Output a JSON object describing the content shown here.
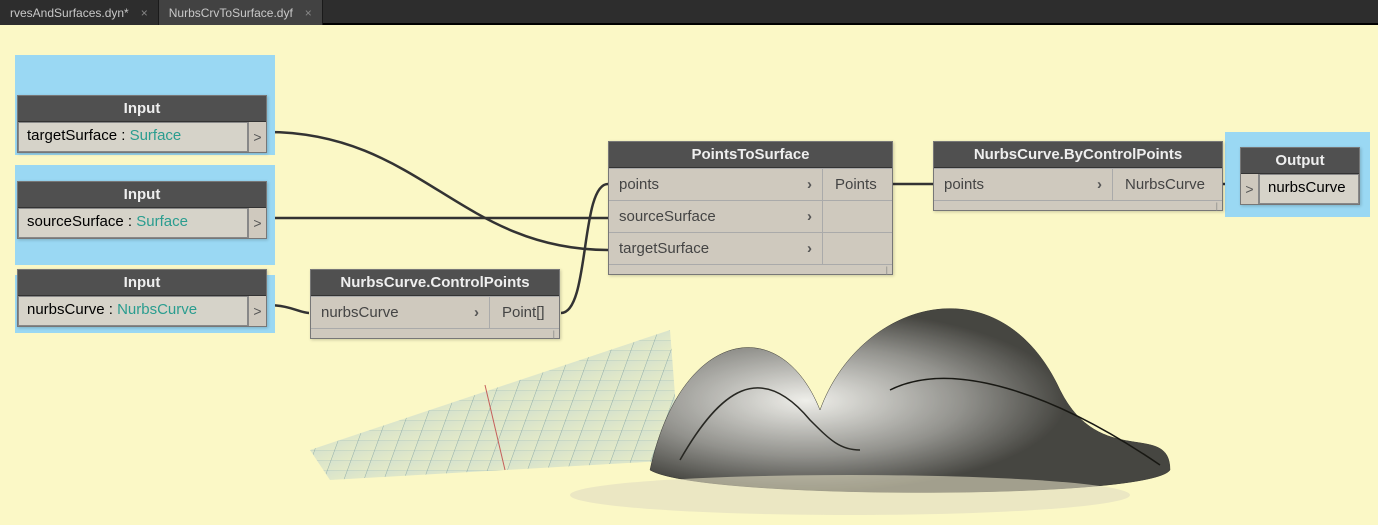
{
  "tabs": [
    {
      "label": "rvesAndSurfaces.dyn*",
      "active": false
    },
    {
      "label": "NurbsCrvToSurface.dyf",
      "active": true
    }
  ],
  "inputs": {
    "header": "Input",
    "targetSurface": {
      "name": "targetSurface",
      "type": "Surface"
    },
    "sourceSurface": {
      "name": "sourceSurface",
      "type": "Surface"
    },
    "nurbsCurve": {
      "name": "nurbsCurve",
      "type": "NurbsCurve"
    }
  },
  "controlPointsNode": {
    "title": "NurbsCurve.ControlPoints",
    "inPort": "nurbsCurve",
    "outPort": "Point[]"
  },
  "pointsToSurfaceNode": {
    "title": "PointsToSurface",
    "inPorts": [
      "points",
      "sourceSurface",
      "targetSurface"
    ],
    "outPort": "Points"
  },
  "byControlPointsNode": {
    "title": "NurbsCurve.ByControlPoints",
    "inPort": "points",
    "outPort": "NurbsCurve"
  },
  "outputNode": {
    "title": "Output",
    "value": "nurbsCurve"
  }
}
